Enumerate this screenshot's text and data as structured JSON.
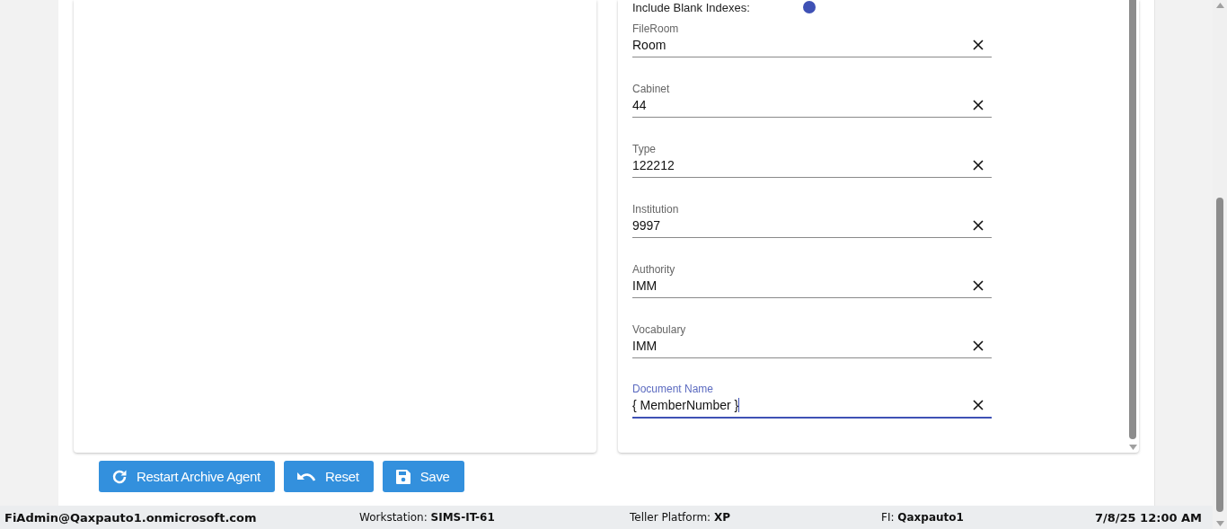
{
  "blank_indexes": {
    "label": "Include Blank Indexes:",
    "on": true
  },
  "fields": [
    {
      "label": "FileRoom",
      "value": "Room",
      "focused": false
    },
    {
      "label": "Cabinet",
      "value": "44",
      "focused": false
    },
    {
      "label": "Type",
      "value": "122212",
      "focused": false
    },
    {
      "label": "Institution",
      "value": "9997",
      "focused": false
    },
    {
      "label": "Authority",
      "value": "IMM",
      "focused": false
    },
    {
      "label": "Vocabulary",
      "value": "IMM",
      "focused": false
    },
    {
      "label": "Document Name",
      "value": "{ MemberNumber }",
      "focused": true
    }
  ],
  "buttons": [
    {
      "kind": "restart",
      "label": "Restart Archive Agent"
    },
    {
      "kind": "reset",
      "label": "Reset"
    },
    {
      "kind": "save",
      "label": "Save"
    }
  ],
  "status_bar": {
    "user": "FiAdmin@Qaxpauto1.onmicrosoft.com",
    "items": [
      {
        "label": "Workstation:",
        "value": "SIMS-IT-61"
      },
      {
        "label": "Teller Platform:",
        "value": "XP"
      },
      {
        "label": "FI:",
        "value": "Qaxpauto1"
      }
    ],
    "datetime": "7/8/25 12:00 AM"
  }
}
